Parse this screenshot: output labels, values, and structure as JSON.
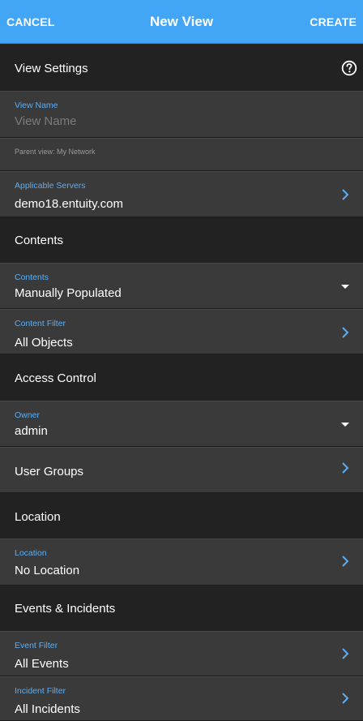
{
  "topbar": {
    "cancel": "CANCEL",
    "title": "New View",
    "create": "CREATE"
  },
  "sections": {
    "view_settings": "View Settings",
    "contents": "Contents",
    "access_control": "Access Control",
    "location": "Location",
    "events_incidents": "Events & Incidents"
  },
  "fields": {
    "view_name": {
      "caption": "View Name",
      "placeholder": "View Name"
    },
    "parent_view": "Parent view: My Network",
    "applicable_servers": {
      "caption": "Applicable Servers",
      "value": "demo18.entuity.com"
    },
    "contents": {
      "caption": "Contents",
      "value": "Manually Populated"
    },
    "content_filter": {
      "caption": "Content Filter",
      "value": "All Objects"
    },
    "owner": {
      "caption": "Owner",
      "value": "admin"
    },
    "user_groups": "User Groups",
    "location": {
      "caption": "Location",
      "value": "No Location"
    },
    "event_filter": {
      "caption": "Event Filter",
      "value": "All Events"
    },
    "incident_filter": {
      "caption": "Incident Filter",
      "value": "All Incidents"
    }
  },
  "icons": {
    "help": "help-circle-icon",
    "chevron": "chevron-right-icon",
    "caret": "caret-down-icon"
  },
  "colors": {
    "accent": "#42a5f5",
    "caption": "#5aaef5",
    "section_bg": "#222222",
    "row_bg": "#3a3a3a"
  }
}
